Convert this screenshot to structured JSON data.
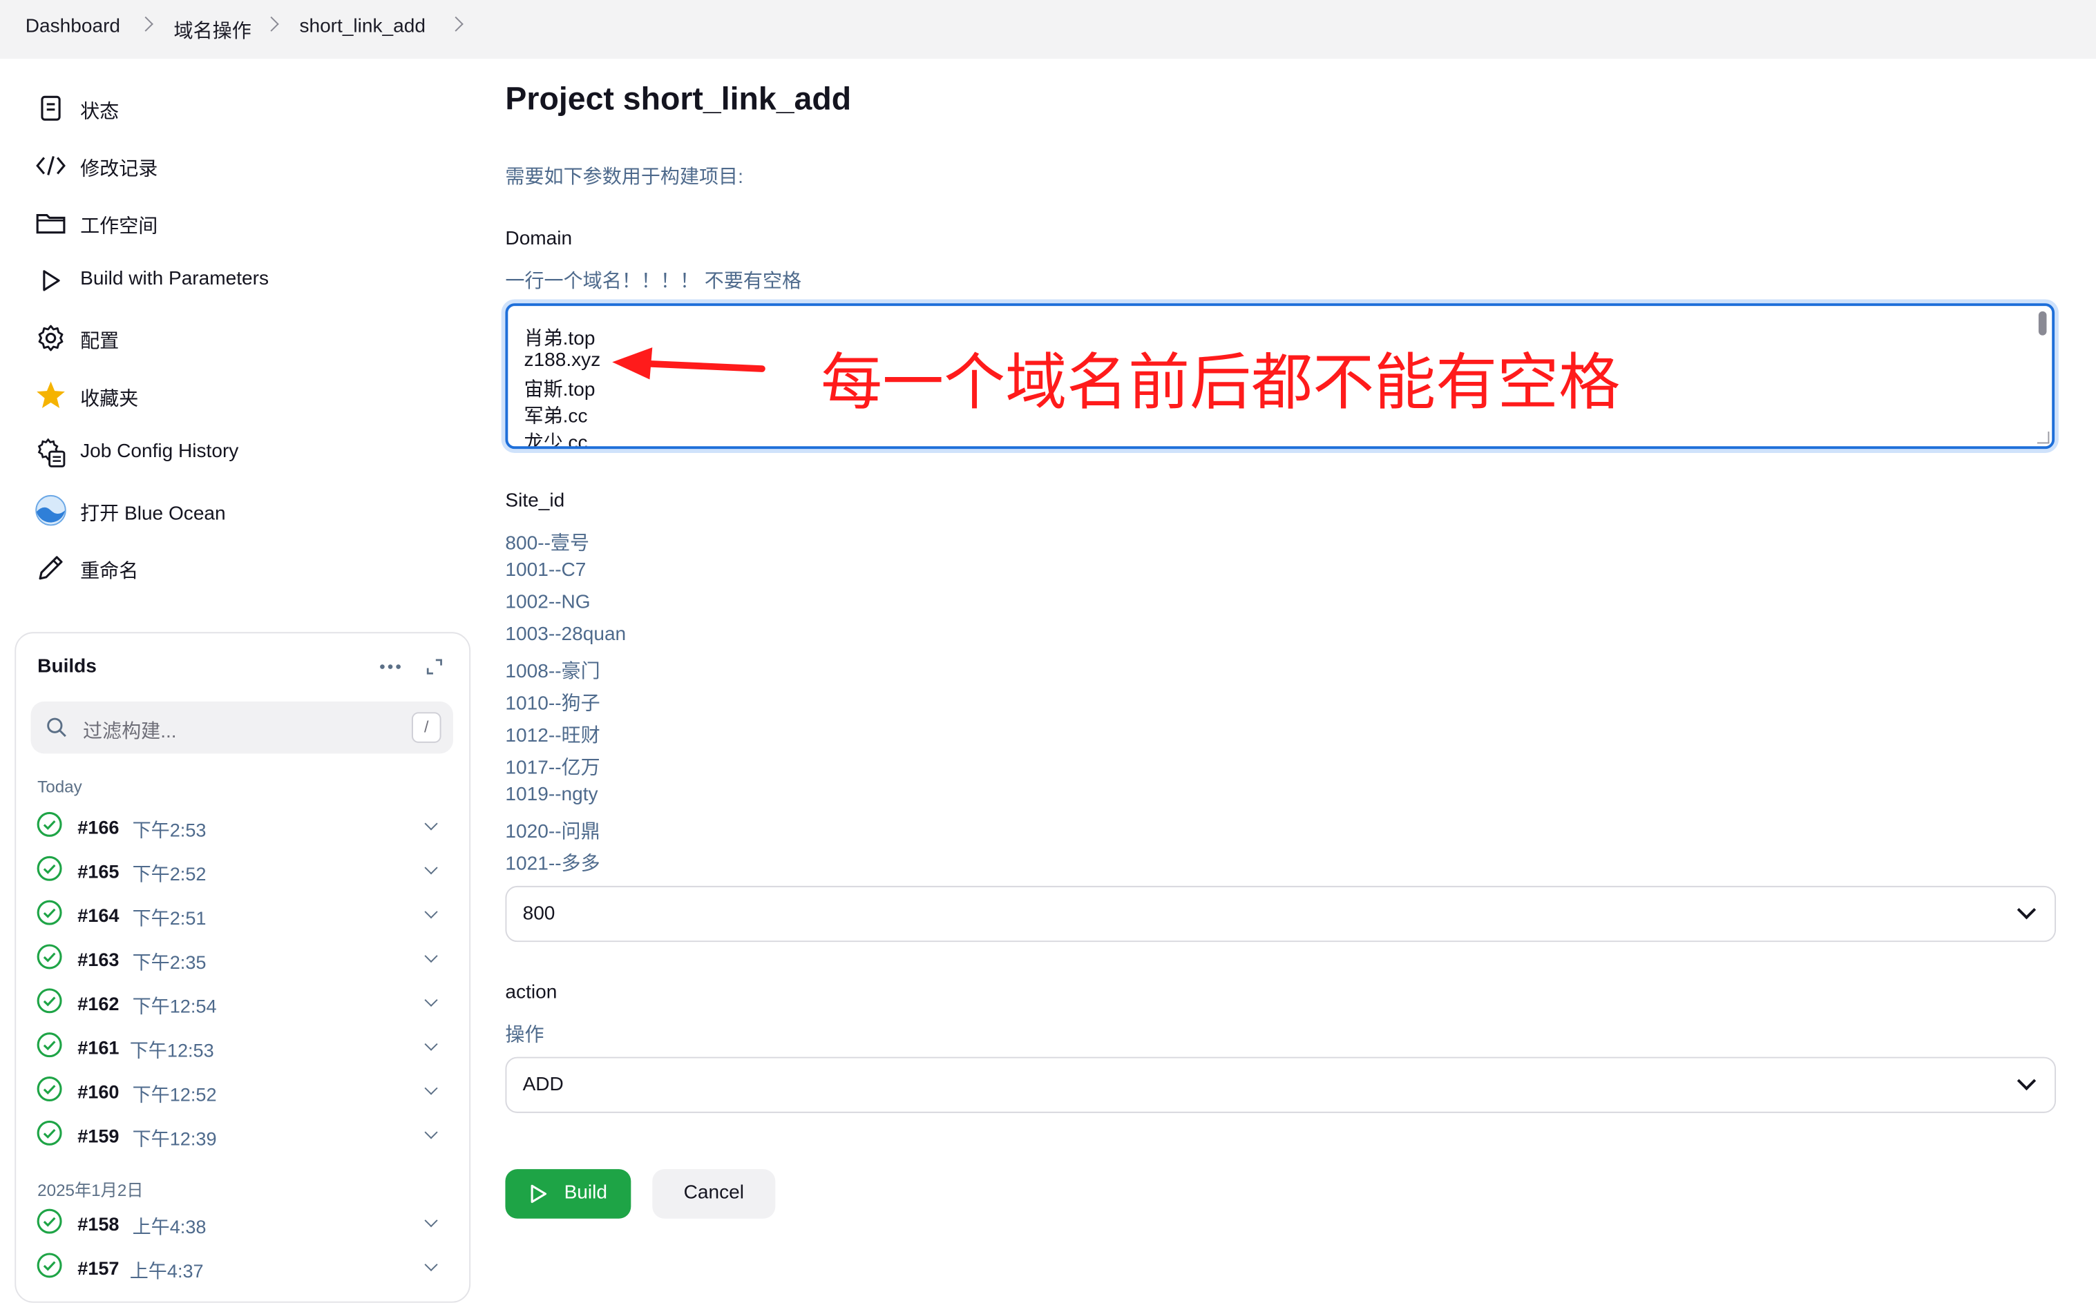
{
  "breadcrumb": [
    "Dashboard",
    "域名操作",
    "short_link_add"
  ],
  "sidebar": {
    "items": [
      {
        "label": "状态",
        "icon": "document-icon"
      },
      {
        "label": "修改记录",
        "icon": "code-icon"
      },
      {
        "label": "工作空间",
        "icon": "folder-icon"
      },
      {
        "label": "Build with Parameters",
        "icon": "play-icon"
      },
      {
        "label": "配置",
        "icon": "gear-icon"
      },
      {
        "label": "收藏夹",
        "icon": "star-icon"
      },
      {
        "label": "Job Config History",
        "icon": "config-history-icon"
      },
      {
        "label": "打开 Blue Ocean",
        "icon": "blue-ocean-icon"
      },
      {
        "label": "重命名",
        "icon": "pencil-icon"
      }
    ]
  },
  "builds": {
    "title": "Builds",
    "filter_placeholder": "过滤构建...",
    "shortcut": "/",
    "groups": [
      {
        "label": "Today",
        "rows": [
          {
            "number": "#166",
            "time": "下午2:53"
          },
          {
            "number": "#165",
            "time": "下午2:52"
          },
          {
            "number": "#164",
            "time": "下午2:51"
          },
          {
            "number": "#163",
            "time": "下午2:35"
          },
          {
            "number": "#162",
            "time": "下午12:54"
          },
          {
            "number": "#161",
            "time": "下午12:53"
          },
          {
            "number": "#160",
            "time": "下午12:52"
          },
          {
            "number": "#159",
            "time": "下午12:39"
          }
        ]
      },
      {
        "label": "2025年1月2日",
        "rows": [
          {
            "number": "#158",
            "time": "上午4:38"
          },
          {
            "number": "#157",
            "time": "上午4:37"
          }
        ]
      }
    ]
  },
  "main": {
    "title": "Project short_link_add",
    "description": "需要如下参数用于构建项目:",
    "domain": {
      "label": "Domain",
      "hint": "一行一个域名！！！！ 不要有空格",
      "lines": [
        "肖弟.top",
        "z188.xyz",
        "宙斯.top",
        "军弟.cc",
        "龙少.cc"
      ],
      "annotation": "每一个域名前后都不能有空格"
    },
    "site_id": {
      "label": "Site_id",
      "options": [
        "800--壹号",
        "1001--C7",
        "1002--NG",
        "1003--28quan",
        "1008--豪门",
        "1010--狗子",
        "1012--旺财",
        "1017--亿万",
        "1019--ngty",
        "1020--问鼎",
        "1021--多多"
      ],
      "selected": "800"
    },
    "action": {
      "label": "action",
      "hint": "操作",
      "selected": "ADD"
    },
    "build_label": "Build",
    "cancel_label": "Cancel"
  },
  "colors": {
    "accent_green": "#1ea446",
    "focus_blue": "#1e6fd9",
    "hint_text": "#4e6a8c",
    "annotation_red": "#ff1b1b"
  }
}
